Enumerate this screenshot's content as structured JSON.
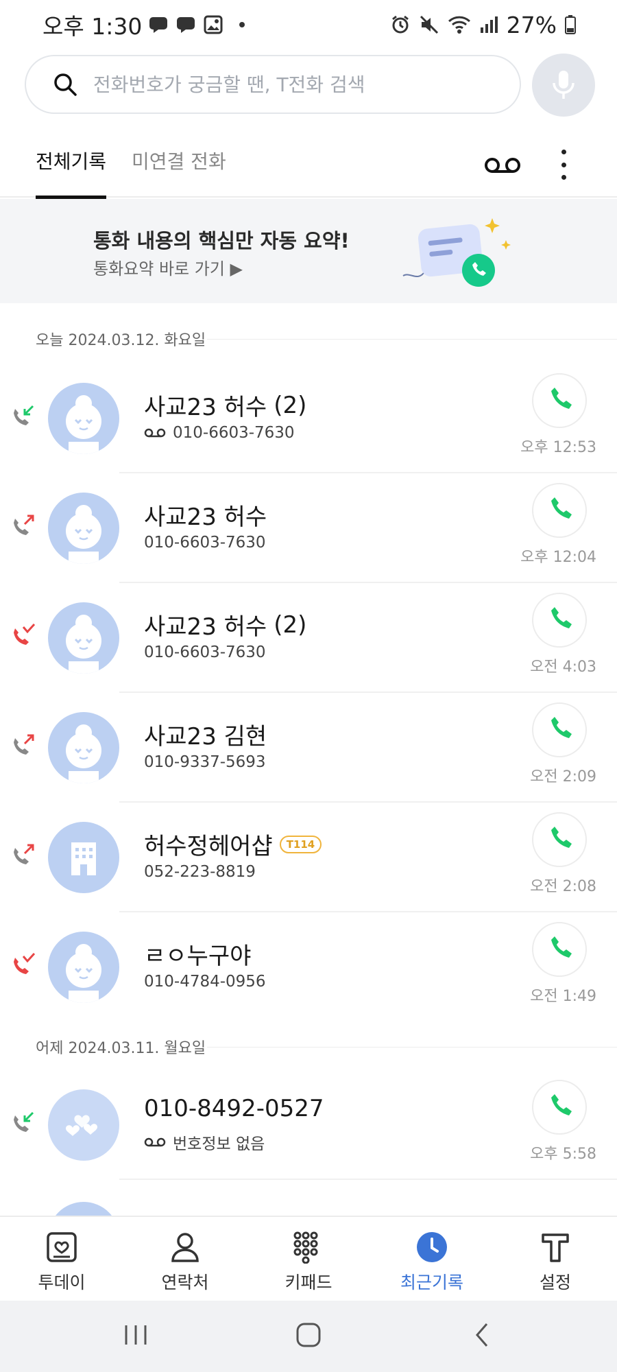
{
  "status_bar": {
    "time": "오후 1:30",
    "battery": "27%"
  },
  "search": {
    "placeholder": "전화번호가 궁금할 땐, T전화 검색"
  },
  "tabs": {
    "all": "전체기록",
    "missed": "미연결 전화"
  },
  "banner": {
    "title": "통화 내용의 핵심만 자동 요약!",
    "link": "통화요약 바로 가기 ▶"
  },
  "sections": [
    {
      "date": "오늘 2024.03.12. 화요일",
      "calls": [
        {
          "name": "사교23 허수",
          "count": "(2)",
          "number": "010-6603-7630",
          "voicemail": true,
          "time": "오후 12:53",
          "direction": "incoming"
        },
        {
          "name": "사교23 허수",
          "count": "",
          "number": "010-6603-7630",
          "voicemail": false,
          "time": "오후 12:04",
          "direction": "outgoing"
        },
        {
          "name": "사교23 허수",
          "count": "(2)",
          "number": "010-6603-7630",
          "voicemail": false,
          "time": "오전 4:03",
          "direction": "missed"
        },
        {
          "name": "사교23 김현",
          "count": "",
          "number": "010-9337-5693",
          "voicemail": false,
          "time": "오전 2:09",
          "direction": "outgoing"
        },
        {
          "name": "허수정헤어샵",
          "count": "",
          "badge": "T114",
          "number": "052-223-8819",
          "voicemail": false,
          "time": "오전 2:08",
          "direction": "outgoing"
        },
        {
          "name": "ㄹㅇ누구야",
          "count": "",
          "number": "010-4784-0956",
          "voicemail": false,
          "time": "오전 1:49",
          "direction": "missed"
        }
      ]
    },
    {
      "date": "어제 2024.03.11. 월요일",
      "calls": [
        {
          "name": "010-8492-0527",
          "count": "",
          "number": "번호정보 없음",
          "voicemail": true,
          "time": "오후 5:58",
          "direction": "incoming"
        }
      ]
    }
  ],
  "bottom_nav": [
    {
      "label": "투데이",
      "icon": "today-icon",
      "active": false
    },
    {
      "label": "연락처",
      "icon": "contacts-icon",
      "active": false
    },
    {
      "label": "키패드",
      "icon": "keypad-icon",
      "active": false
    },
    {
      "label": "최근기록",
      "icon": "recent-icon",
      "active": true
    },
    {
      "label": "설정",
      "icon": "settings-t-icon",
      "active": false
    }
  ],
  "colors": {
    "accent_blue": "#3b74d6",
    "call_green": "#1ec96a",
    "missed_red": "#e84545",
    "avatar_bg": "#bcd0f2"
  }
}
